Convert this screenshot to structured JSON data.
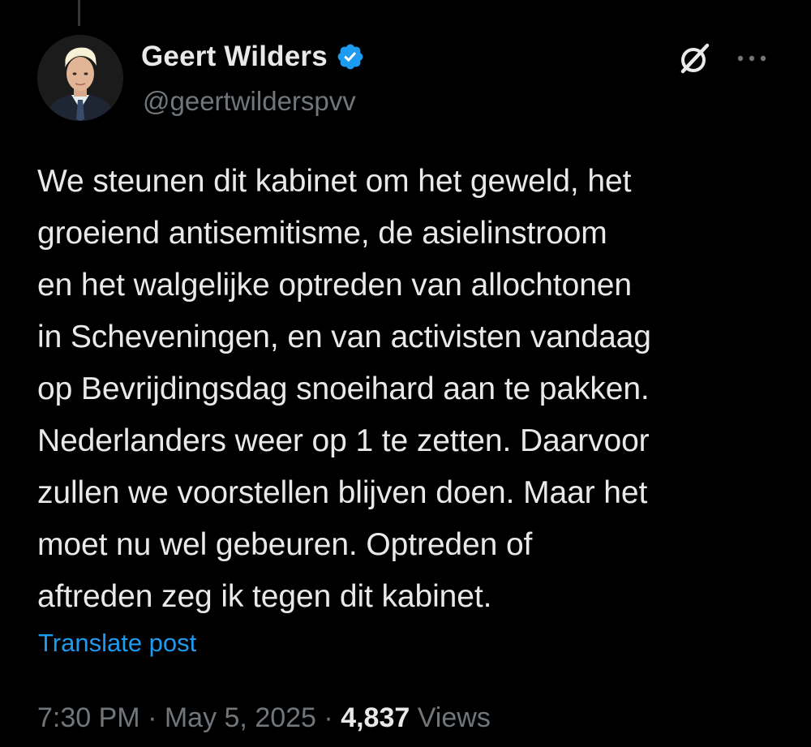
{
  "author": {
    "display_name": "Geert Wilders",
    "handle": "@geertwilderspvv",
    "verified": true,
    "verified_color": "#1d9bf0"
  },
  "icons": {
    "avatar": "profile-photo",
    "verified": "verified-badge-icon",
    "grok": "grok-icon",
    "more": "more-options-icon"
  },
  "post": {
    "text": "We steunen dit kabinet om het geweld, het\ngroeiend antisemitisme, de asielinstroom\nen het walgelijke optreden van allochtonen\nin Scheveningen, en van activisten vandaag\nop Bevrijdingsdag snoeihard aan te pakken.\nNederlanders weer op 1 te zetten. Daarvoor\nzullen we voorstellen blijven doen. Maar het\nmoet nu wel gebeuren. Optreden of\naftreden zeg ik tegen dit kabinet.",
    "translate_label": "Translate post"
  },
  "meta": {
    "time": "7:30 PM",
    "separator": " · ",
    "date": "May 5, 2025",
    "views_count": "4,837",
    "views_label": "Views"
  },
  "colors": {
    "background": "#000000",
    "primary_text": "#e7e9ea",
    "secondary_text": "#71767b",
    "link": "#1d9bf0"
  }
}
